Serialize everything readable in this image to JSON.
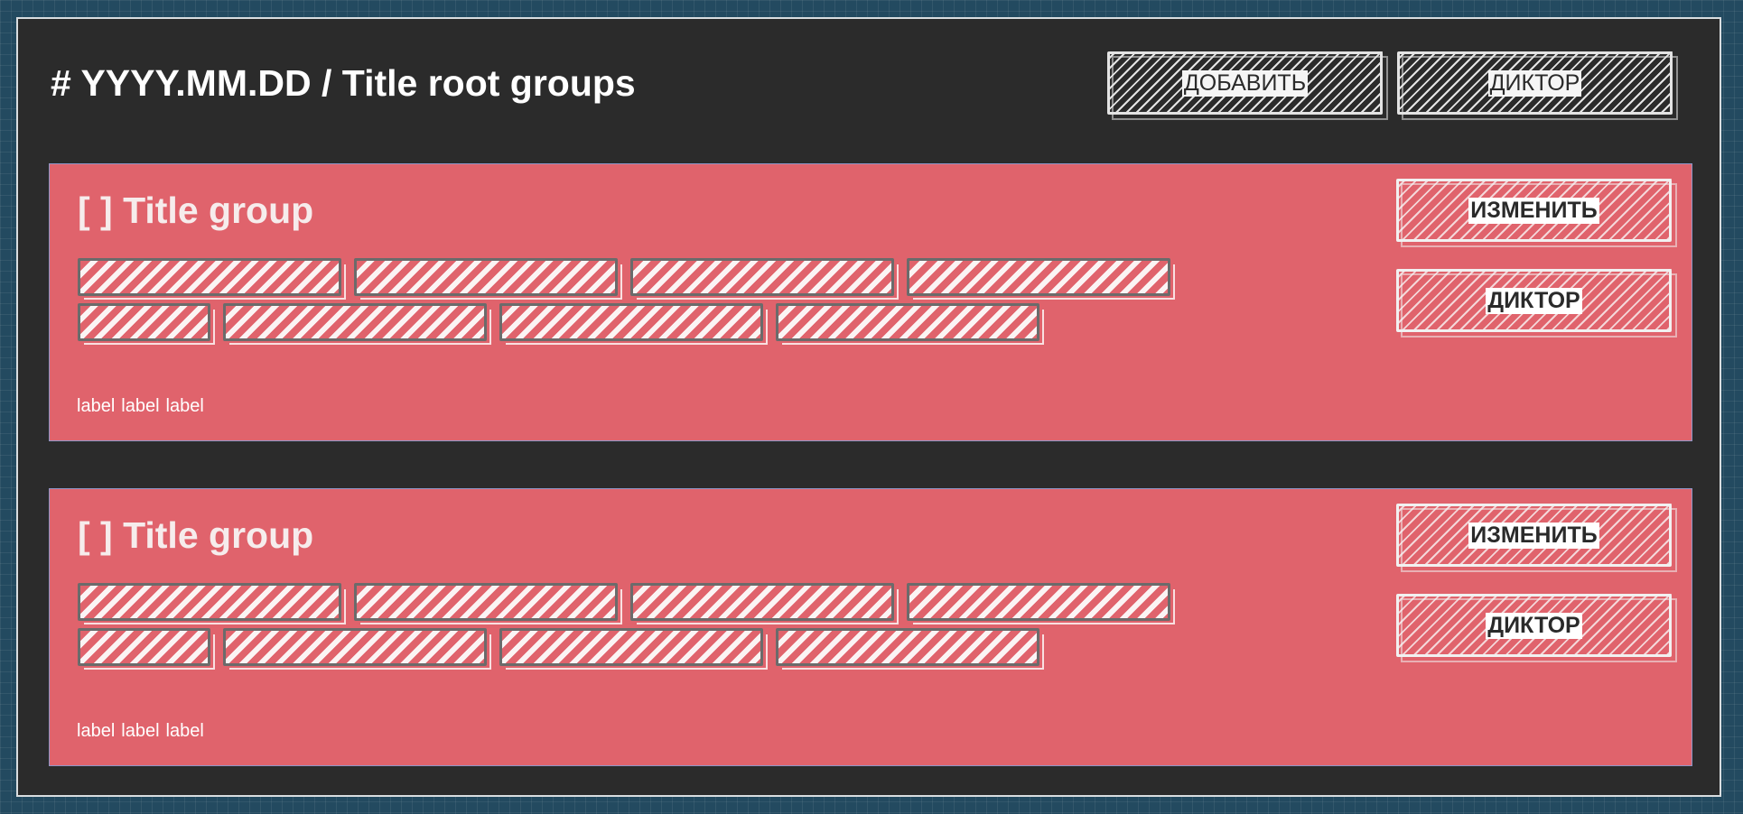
{
  "header": {
    "title": "# YYYY.MM.DD / Title root groups",
    "add_button": "ДОБАВИТЬ",
    "speaker_button": "ДИКТОР"
  },
  "groups": [
    {
      "title": "[ ] Title group",
      "edit_button": "ИЗМЕНИТЬ",
      "speaker_button": "ДИКТОР",
      "labels": [
        "label",
        "label",
        "label"
      ]
    },
    {
      "title": "[ ] Title group",
      "edit_button": "ИЗМЕНИТЬ",
      "speaker_button": "ДИКТОР",
      "labels": [
        "label",
        "label",
        "label"
      ]
    }
  ],
  "colors": {
    "background": "#234a60",
    "panel": "#2b2b2b",
    "group": "#e0636c",
    "text": "#ffffff"
  }
}
